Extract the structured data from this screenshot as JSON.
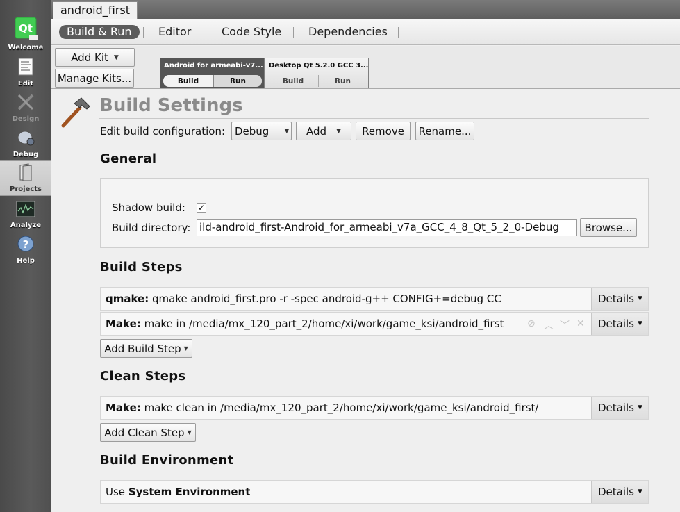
{
  "modebar": {
    "items": [
      {
        "label": "Welcome",
        "icon": "qt-logo-icon"
      },
      {
        "label": "Edit",
        "icon": "document-icon"
      },
      {
        "label": "Design",
        "icon": "design-icon"
      },
      {
        "label": "Debug",
        "icon": "bug-icon"
      },
      {
        "label": "Projects",
        "icon": "folder-icon"
      },
      {
        "label": "Analyze",
        "icon": "oscilloscope-icon"
      },
      {
        "label": "Help",
        "icon": "help-icon"
      }
    ]
  },
  "tab": {
    "label": "android_first"
  },
  "subnav": {
    "build_run": "Build & Run",
    "editor": "Editor",
    "code_style": "Code Style",
    "dependencies": "Dependencies"
  },
  "kits": {
    "add_kit": "Add Kit",
    "manage_kits": "Manage Kits...",
    "list": [
      {
        "name": "Android for armeabi-v7...",
        "build": "Build",
        "run": "Run"
      },
      {
        "name": "Desktop Qt 5.2.0 GCC 3...",
        "build": "Build",
        "run": "Run"
      }
    ]
  },
  "build_settings": {
    "title": "Build Settings",
    "edit_config_label": "Edit build configuration:",
    "config_value": "Debug",
    "add": "Add",
    "remove": "Remove",
    "rename": "Rename..."
  },
  "general": {
    "heading": "General",
    "shadow_build_label": "Shadow build:",
    "shadow_build_checked": "✓",
    "build_dir_label": "Build directory:",
    "build_dir_value": "ild-android_first-Android_for_armeabi_v7a_GCC_4_8_Qt_5_2_0-Debug",
    "browse": "Browse..."
  },
  "build_steps": {
    "heading": "Build Steps",
    "steps": [
      {
        "name": "qmake:",
        "text": "qmake android_first.pro -r -spec android-g++ CONFIG+=debug CC",
        "details": "Details"
      },
      {
        "name": "Make:",
        "text": "make in /media/mx_120_part_2/home/xi/work/game_ksi/android_first",
        "details": "Details"
      }
    ],
    "add_step": "Add Build Step"
  },
  "clean_steps": {
    "heading": "Clean Steps",
    "steps": [
      {
        "name": "Make:",
        "text": "make clean in /media/mx_120_part_2/home/xi/work/game_ksi/android_first/",
        "details": "Details"
      }
    ],
    "add_step": "Add Clean Step"
  },
  "build_env": {
    "heading": "Build Environment",
    "use_label": "Use",
    "env_name": "System Environment",
    "details": "Details"
  }
}
